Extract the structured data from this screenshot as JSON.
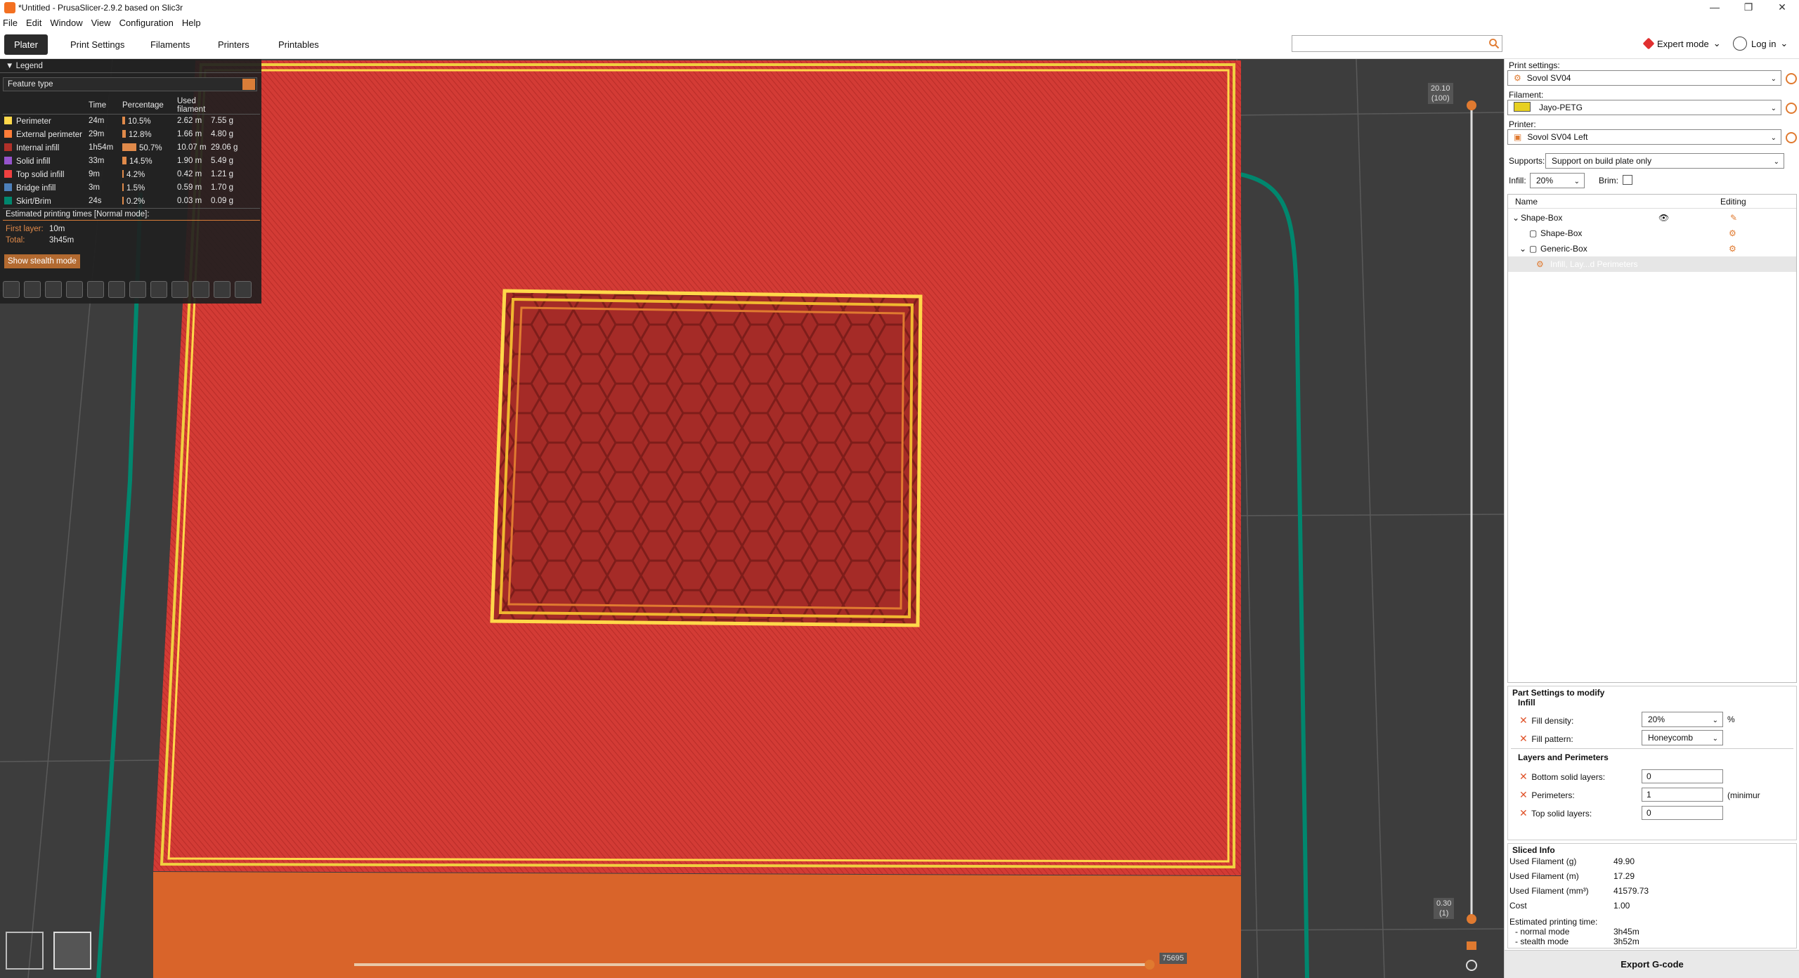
{
  "window": {
    "title": "*Untitled - PrusaSlicer-2.9.2 based on Slic3r",
    "controls": [
      "—",
      "❐",
      "✕"
    ]
  },
  "menu": [
    "File",
    "Edit",
    "Window",
    "View",
    "Configuration",
    "Help"
  ],
  "tabs": [
    "Plater",
    "Print Settings",
    "Filaments",
    "Printers",
    "Printables"
  ],
  "active_tab": "Plater",
  "search": {
    "placeholder": ""
  },
  "mode": {
    "label": "Expert mode",
    "color": "#e03030"
  },
  "login": {
    "label": "Log in"
  },
  "legend": {
    "header": "Legend",
    "view_type": "Feature type",
    "columns": [
      "",
      "Time",
      "Percentage",
      "Used filament",
      ""
    ],
    "rows": [
      {
        "name": "Perimeter",
        "color": "#ffd84a",
        "time": "24m",
        "percent": "10.5%",
        "length": "2.62 m",
        "weight": "7.55 g",
        "fraction": 0.105
      },
      {
        "name": "External perimeter",
        "color": "#ff7d38",
        "time": "29m",
        "percent": "12.8%",
        "length": "1.66 m",
        "weight": "4.80 g",
        "fraction": 0.128
      },
      {
        "name": "Internal infill",
        "color": "#b03029",
        "time": "1h54m",
        "percent": "50.7%",
        "length": "10.07 m",
        "weight": "29.06 g",
        "fraction": 0.507
      },
      {
        "name": "Solid infill",
        "color": "#9654cc",
        "time": "33m",
        "percent": "14.5%",
        "length": "1.90 m",
        "weight": "5.49 g",
        "fraction": 0.145
      },
      {
        "name": "Top solid infill",
        "color": "#f04040",
        "time": "9m",
        "percent": "4.2%",
        "length": "0.42 m",
        "weight": "1.21 g",
        "fraction": 0.042
      },
      {
        "name": "Bridge infill",
        "color": "#4d80ba",
        "time": "3m",
        "percent": "1.5%",
        "length": "0.59 m",
        "weight": "1.70 g",
        "fraction": 0.015
      },
      {
        "name": "Skirt/Brim",
        "color": "#00876e",
        "time": "24s",
        "percent": "0.2%",
        "length": "0.03 m",
        "weight": "0.09 g",
        "fraction": 0.002
      }
    ],
    "estimated_title": "Estimated printing times [Normal mode]:",
    "first_layer_label": "First layer:",
    "first_layer_value": "10m",
    "total_label": "Total:",
    "total_value": "3h45m",
    "stealth_button": "Show stealth mode"
  },
  "slider": {
    "top_value": "20.10",
    "top_layer": "(100)",
    "bottom_value": "0.30",
    "bottom_layer": "(1)",
    "horizontal_value": "75695"
  },
  "right_panel": {
    "print_settings_label": "Print settings:",
    "print_settings_value": "Sovol SV04",
    "filament_label": "Filament:",
    "filament_value": "Jayo-PETG",
    "filament_color": "#e8d020",
    "printer_label": "Printer:",
    "printer_value": "Sovol SV04 Left",
    "supports_label": "Supports:",
    "supports_value": "Support on build plate only",
    "infill_label": "Infill:",
    "infill_value": "20%",
    "brim_label": "Brim:",
    "object_list": {
      "col_name": "Name",
      "col_editing": "Editing",
      "items": [
        "Shape-Box",
        "Shape-Box",
        "Generic-Box",
        "Infill, Lay...d Perimeters"
      ]
    },
    "part_settings": {
      "title": "Part Settings to modify",
      "infill_group": "Infill",
      "fill_density_label": "Fill density:",
      "fill_density_value": "20%",
      "fill_density_unit": "%",
      "fill_pattern_label": "Fill pattern:",
      "fill_pattern_value": "Honeycomb",
      "layers_group": "Layers and Perimeters",
      "bottom_solid_label": "Bottom solid layers:",
      "bottom_solid_value": "0",
      "perimeters_label": "Perimeters:",
      "perimeters_value": "1",
      "perimeters_note": "(minimur",
      "top_solid_label": "Top solid layers:",
      "top_solid_value": "0"
    },
    "sliced_info": {
      "title": "Sliced Info",
      "rows": [
        {
          "label": "Used Filament (g)",
          "value": "49.90"
        },
        {
          "label": "Used Filament (m)",
          "value": "17.29"
        },
        {
          "label": "Used Filament (mm³)",
          "value": "41579.73"
        },
        {
          "label": "Cost",
          "value": "1.00"
        }
      ],
      "est_label": "Estimated printing time:",
      "normal_label": "- normal mode",
      "normal_value": "3h45m",
      "stealth_label": "- stealth mode",
      "stealth_value": "3h52m"
    },
    "export_button": "Export G-code"
  }
}
